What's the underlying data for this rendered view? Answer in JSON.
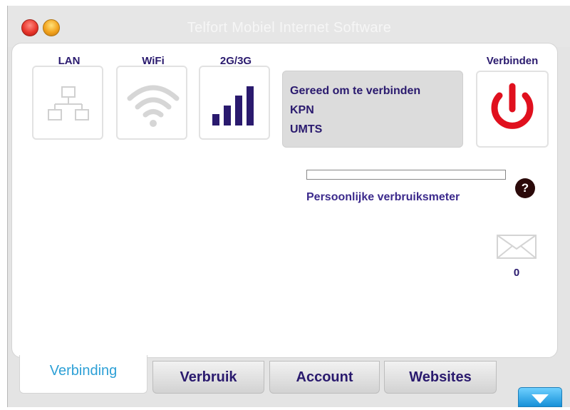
{
  "window": {
    "title": "Telfort Mobiel Internet Software"
  },
  "connection_types": [
    {
      "label": "LAN",
      "icon": "network-icon",
      "active": false
    },
    {
      "label": "WiFi",
      "icon": "wifi-icon",
      "active": false
    },
    {
      "label": "2G/3G",
      "icon": "signal-bars-icon",
      "active": true
    }
  ],
  "status": {
    "line1": "Gereed om te verbinden",
    "line2": "KPN",
    "line3": "UMTS"
  },
  "connect": {
    "label": "Verbinden",
    "icon": "power-icon",
    "color": "#e0101e"
  },
  "usage": {
    "progress_fraction": 0,
    "meter_label": "Persoonlijke verbruiksmeter",
    "help_label": "?"
  },
  "messages": {
    "icon": "envelope-icon",
    "count": "0"
  },
  "tabs": [
    {
      "label": "Verbinding",
      "active": true
    },
    {
      "label": "Verbruik",
      "active": false
    },
    {
      "label": "Account",
      "active": false
    },
    {
      "label": "Websites",
      "active": false
    }
  ],
  "colors": {
    "accent": "#2a1a6e",
    "active_tab": "#2da0d6",
    "power": "#e0101e",
    "expand_button": "#2aa8ea"
  },
  "icons": {
    "close": "close-window-icon",
    "minimize": "minimize-window-icon",
    "expand": "chevron-down-icon"
  }
}
